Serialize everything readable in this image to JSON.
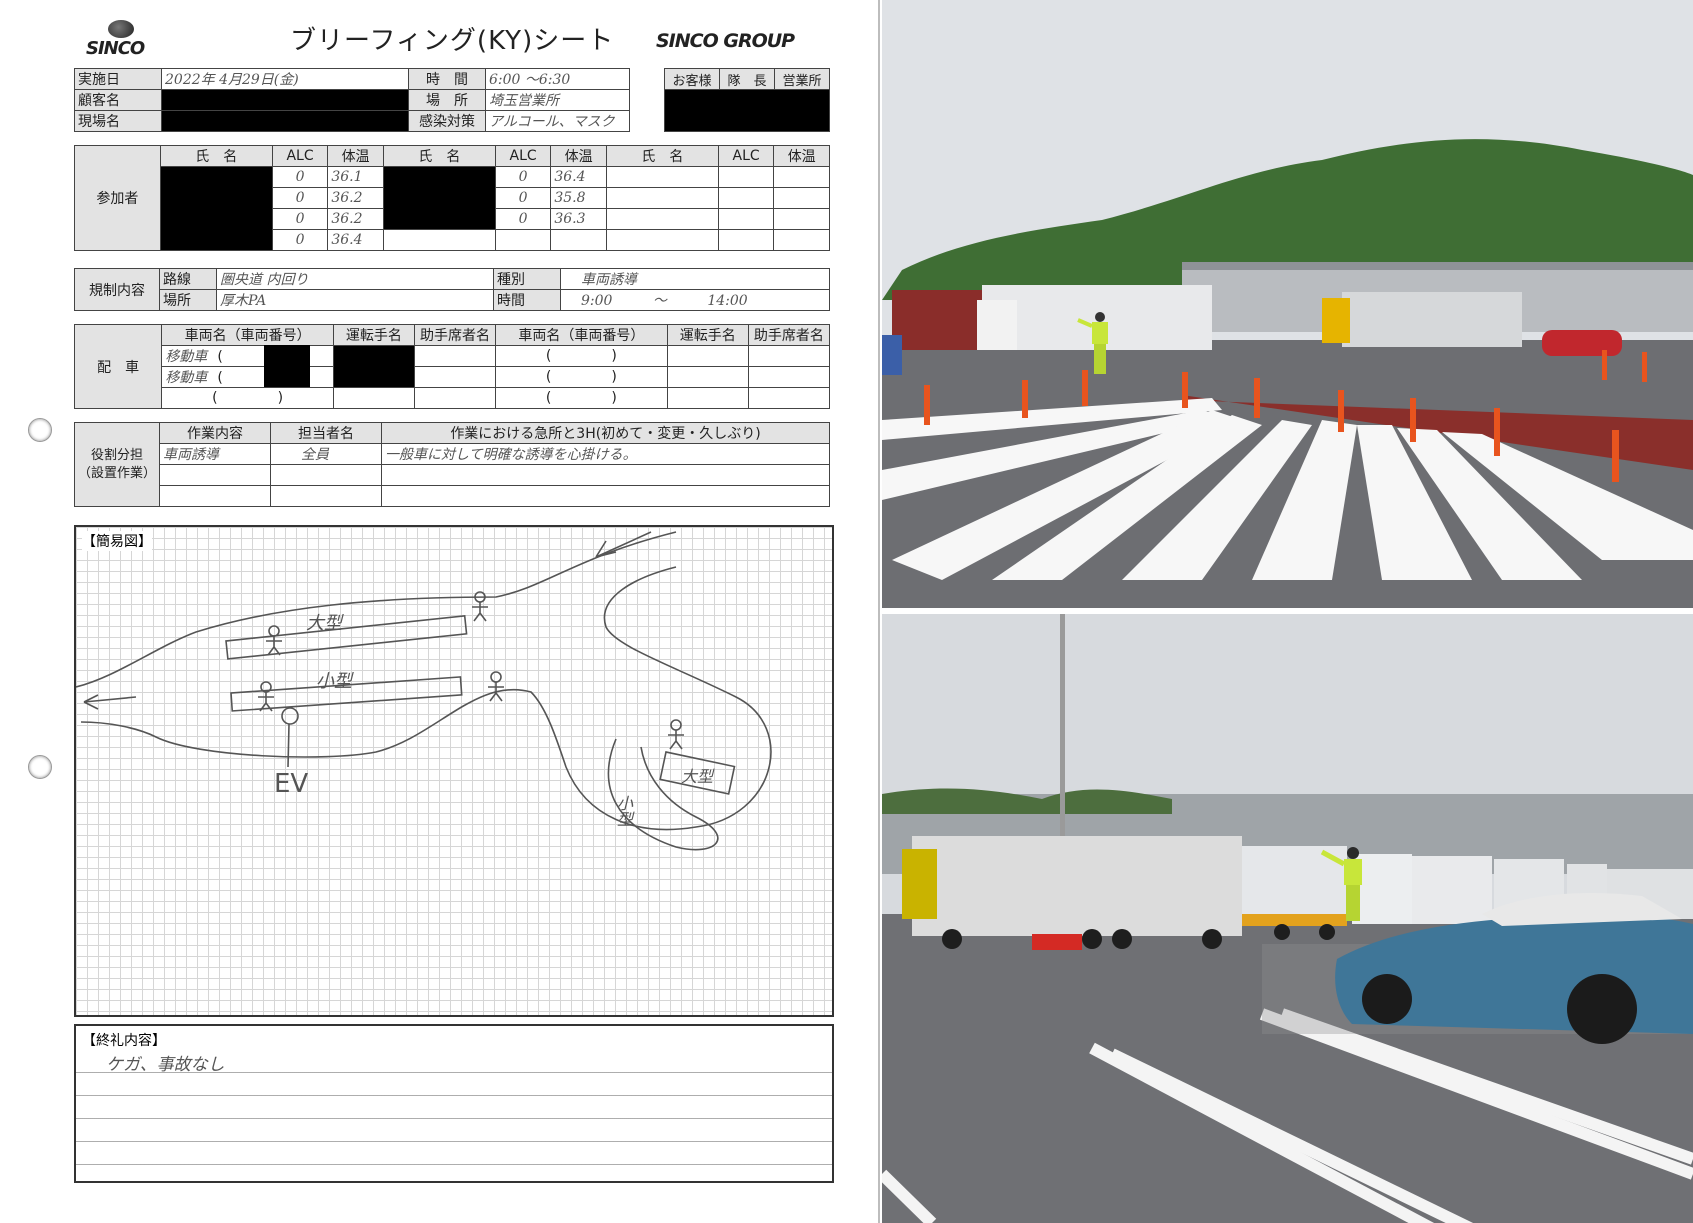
{
  "header": {
    "logo_left": "SINCO",
    "title": "ブリーフィング(KY)シート",
    "logo_right": "SINCO GROUP"
  },
  "info": {
    "date_label": "実施日",
    "date_value": "2022年 4月29日(金)",
    "time_label": "時　間",
    "time_value": "6:00 ～6:30",
    "customer_label": "顧客名",
    "place_label": "場　所",
    "place_value": "埼玉営業所",
    "site_label": "現場名",
    "infection_label": "感染対策",
    "infection_value": "アルコール、マスク",
    "stamp_headers": [
      "お客様",
      "隊　長",
      "営業所"
    ]
  },
  "participants": {
    "label": "参加者",
    "col_headers": [
      "氏　名",
      "ALC",
      "体温"
    ],
    "group1": [
      {
        "alc": "0",
        "temp": "36.1"
      },
      {
        "alc": "0",
        "temp": "36.2"
      },
      {
        "alc": "0",
        "temp": "36.2"
      },
      {
        "alc": "0",
        "temp": "36.4"
      }
    ],
    "group2": [
      {
        "alc": "0",
        "temp": "36.4"
      },
      {
        "alc": "0",
        "temp": "35.8"
      },
      {
        "alc": "0",
        "temp": "36.3"
      }
    ]
  },
  "regulation": {
    "label": "規制内容",
    "route_label": "路線",
    "route_value": "圏央道 内回り",
    "type_label": "種別",
    "type_value": "車両誘導",
    "area_label": "場所",
    "area_value": "厚木PA",
    "time_label": "時間",
    "time_start": "9:00",
    "time_sep": "～",
    "time_end": "14:00"
  },
  "dispatch": {
    "label": "配　車",
    "col_headers": [
      "車両名（車両番号）",
      "運転手名",
      "助手席者名",
      "車両名（車両番号）",
      "運転手名",
      "助手席者名"
    ],
    "vehicles": [
      "移動車",
      "移動車"
    ],
    "paren_open": "(",
    "paren_close": ")"
  },
  "roles": {
    "label": "役割分担\n（設置作業）",
    "col_headers": [
      "作業内容",
      "担当者名",
      "作業における急所と3H(初めて・変更・久しぶり)"
    ],
    "task": "車両誘導",
    "person": "全員",
    "point": "一般車に対して明確な誘導を心掛ける。"
  },
  "diagram": {
    "label": "【簡易図】",
    "large_top": "大型",
    "small": "小型",
    "ev": "EV",
    "large_right": "大型",
    "small_right": "小型"
  },
  "closing": {
    "label": "【終礼内容】",
    "text": "ケガ、事故なし"
  },
  "colors": {
    "sky": "#dfe2e6",
    "asphalt": "#6d6e72",
    "trees": "#3f6e34",
    "red_lane": "#8a2f2b",
    "vest": "#c8e63a",
    "car_blue": "#3f7698"
  }
}
